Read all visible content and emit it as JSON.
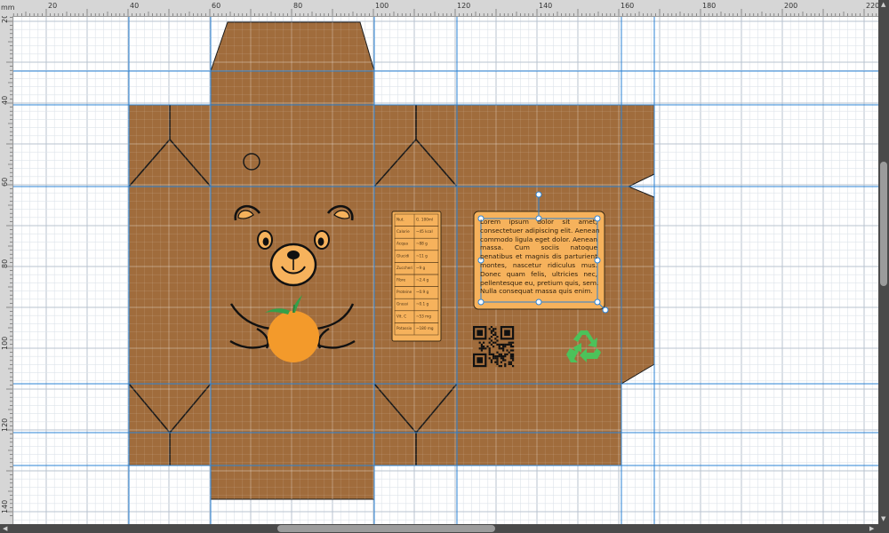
{
  "ruler": {
    "unit": "mm",
    "top_labels": [
      "20",
      "40",
      "60",
      "80",
      "100",
      "120",
      "140",
      "160",
      "180",
      "200",
      "220"
    ],
    "left_labels": [
      "20",
      "40",
      "60",
      "80",
      "100",
      "120",
      "140"
    ]
  },
  "nutrition": {
    "header": [
      "Nut.",
      "G. 100ml"
    ],
    "rows": [
      [
        "Calorie",
        "~45 kcal"
      ],
      [
        "Acqua",
        "~88 g"
      ],
      [
        "Glucidi",
        "~11 g"
      ],
      [
        "Zuccheri",
        "~9 g"
      ],
      [
        "Fibre",
        "~2.4 g"
      ],
      [
        "Proteine",
        "~0.9 g"
      ],
      [
        "Grassi",
        "~0.1 g"
      ],
      [
        "Vit. C",
        "~53 mg"
      ],
      [
        "Potassio",
        "~180 mg"
      ]
    ]
  },
  "lorem_lines": [
    "Lorem ipsum dolor sit amet,",
    "consectetuer adipiscing elit. Aenean",
    "commodo ligula eget dolor. Aenean",
    "massa. Cum sociis natoque",
    "penatibus et magnis dis parturient",
    "montes, nascetur ridiculus mus.",
    "Donec quam felis, ultricies nec,",
    "pellentesque eu, pretium quis, sem.",
    "Nulla consequat massa quis enim."
  ],
  "colors": {
    "cardboard": "#a06c3c",
    "label_fill": "#f6b25c",
    "orange": "#f39a2b",
    "leaf": "#34a04a",
    "recycle": "#4cc25a",
    "guide": "#2b83d6",
    "page_bg": "#ffffff"
  },
  "icons": {
    "recycle": "recycle-icon",
    "qr": "qr-code-icon"
  }
}
